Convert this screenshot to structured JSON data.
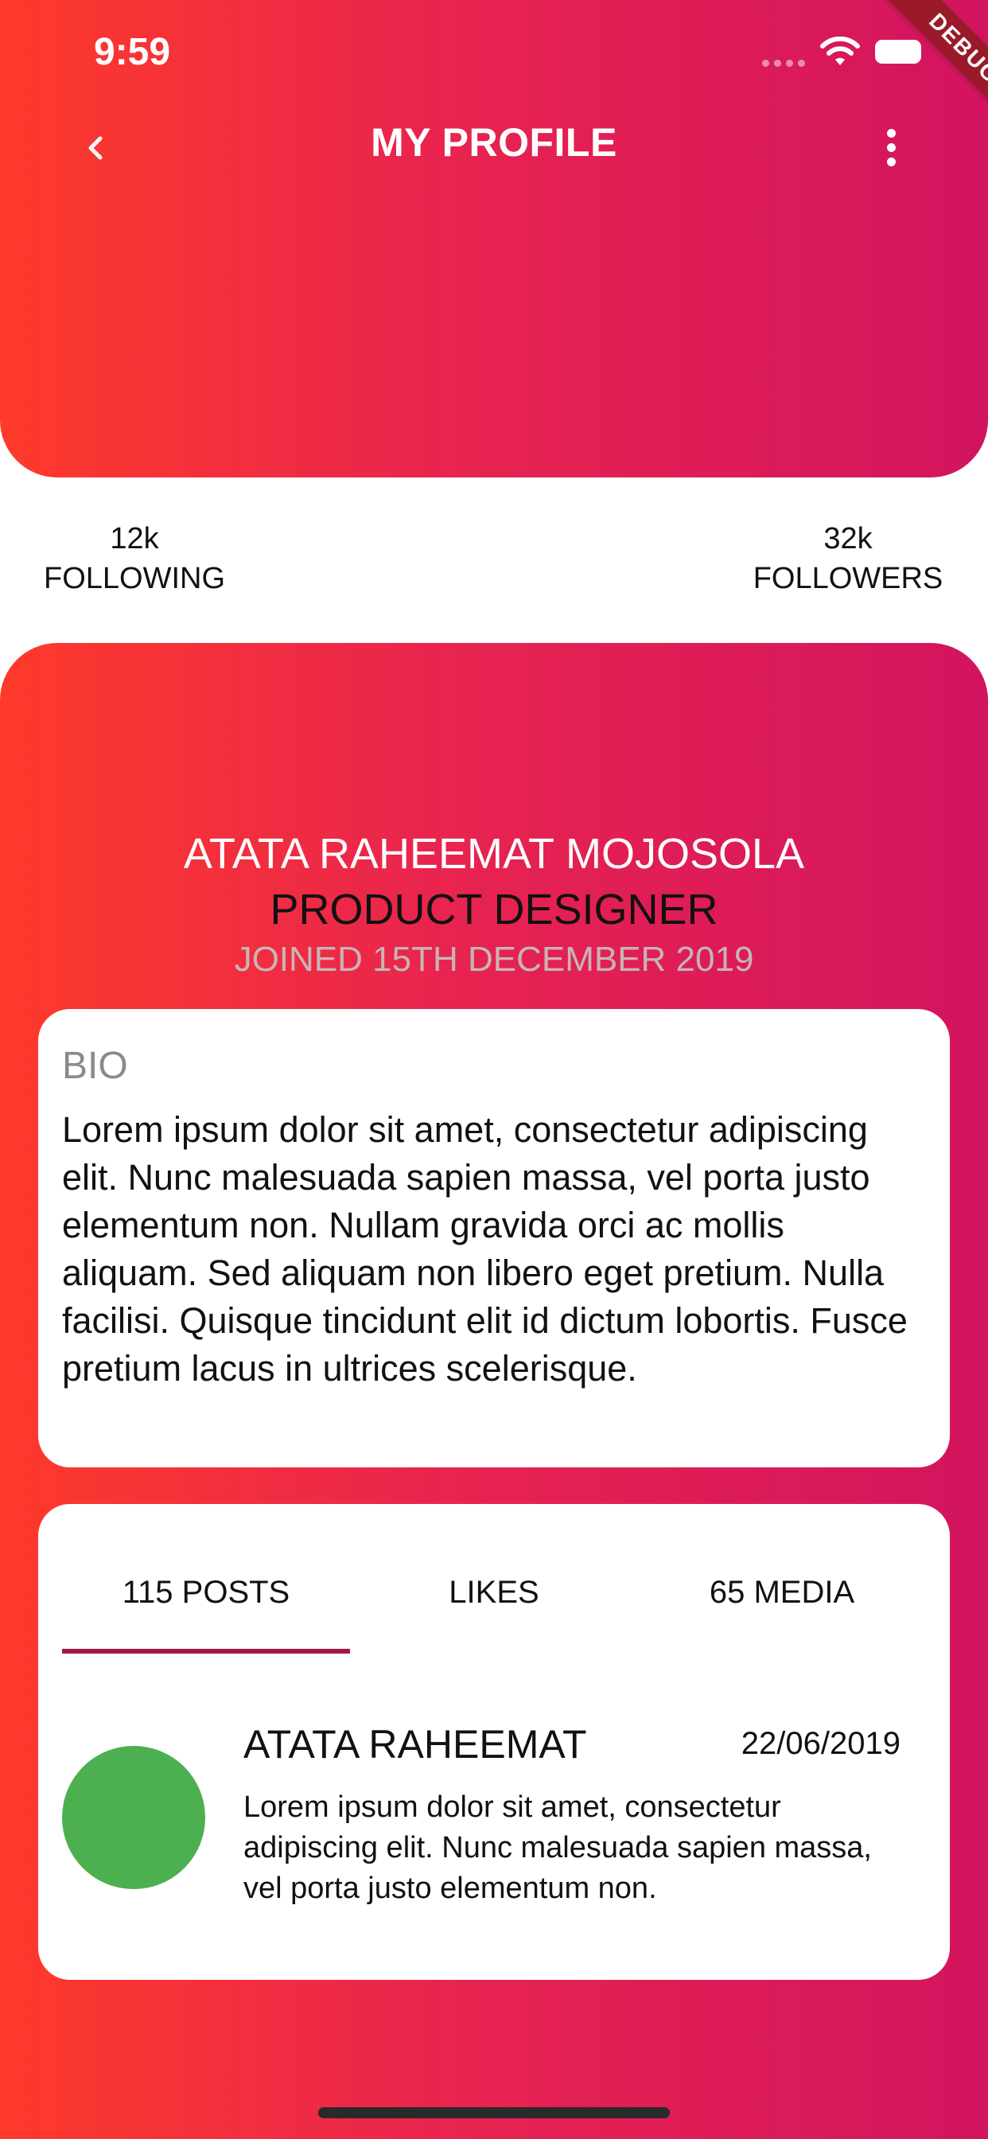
{
  "status_bar": {
    "time": "9:59",
    "debug_label": "DEBUG"
  },
  "topbar": {
    "title": "MY PROFILE",
    "back_icon": "chevron-left-icon",
    "more_icon": "more-vertical-icon"
  },
  "stats": {
    "following_count": "12k",
    "following_label": "FOLLOWING",
    "followers_count": "32k",
    "followers_label": "FOLLOWERS"
  },
  "profile": {
    "name": "ATATA RAHEEMAT MOJOSOLA",
    "role": "PRODUCT DESIGNER",
    "joined": "JOINED 15TH DECEMBER 2019"
  },
  "bio": {
    "label": "BIO",
    "text": "Lorem ipsum dolor sit amet, consectetur adipiscing elit. Nunc malesuada sapien massa, vel porta justo elementum non. Nullam gravida orci ac mollis aliquam. Sed aliquam non libero eget pretium. Nulla facilisi. Quisque tincidunt elit id dictum lobortis. Fusce pretium lacus in ultrices scelerisque."
  },
  "tabs": [
    {
      "label": "115 POSTS",
      "active": true
    },
    {
      "label": "LIKES",
      "active": false
    },
    {
      "label": "65 MEDIA",
      "active": false
    }
  ],
  "posts": [
    {
      "author": "ATATA RAHEEMAT",
      "date": "22/06/2019",
      "body": "Lorem ipsum dolor sit amet, consectetur adipiscing elit. Nunc malesuada sapien massa, vel porta justo elementum non."
    }
  ],
  "colors": {
    "gradient_start": "#fe3a2b",
    "gradient_end": "#d2145f",
    "tab_indicator": "#a2184d",
    "avatar": "#4caf50"
  }
}
